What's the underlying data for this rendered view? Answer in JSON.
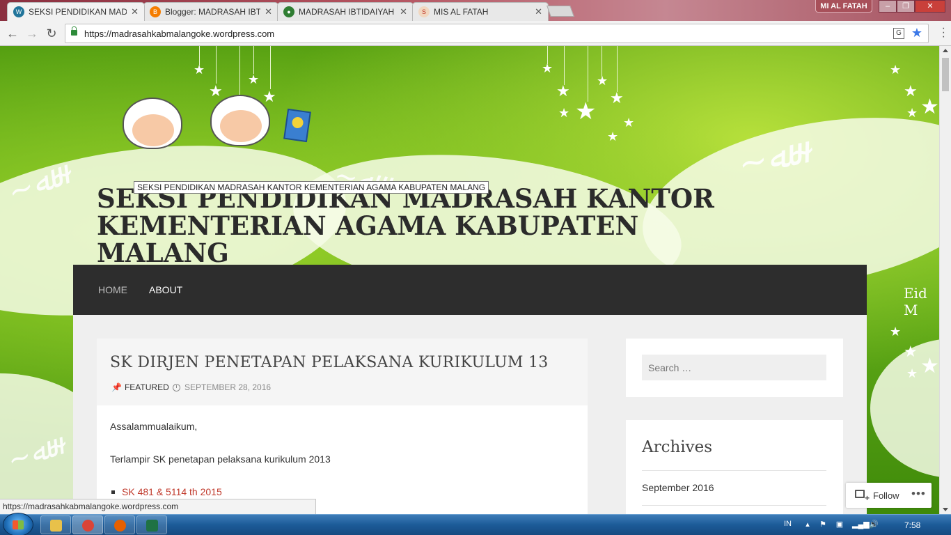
{
  "browser": {
    "tabs": [
      {
        "label": "SEKSI PENDIDIKAN MAD",
        "favicon": "wordpress-icon",
        "color": "#21759b",
        "active": true
      },
      {
        "label": "Blogger: MADRASAH IBT",
        "favicon": "blogger-icon",
        "color": "#f57d00",
        "active": false
      },
      {
        "label": "MADRASAH IBTIDAIYAH",
        "favicon": "kemenag-icon",
        "color": "#2f7d32",
        "active": false
      },
      {
        "label": "MIS AL FATAH",
        "favicon": "ship-icon",
        "color": "#e0e0e0",
        "active": false
      }
    ],
    "profile_name": "MI AL FATAH",
    "url": "https://madrasahkabmalangoke.wordpress.com",
    "status_url": "https://madrasahkabmalangoke.wordpress.com"
  },
  "site": {
    "tooltip": "SEKSI PENDIDIKAN MADRASAH KANTOR KEMENTERIAN AGAMA KABUPATEN MALANG",
    "title": "SEKSI PENDIDIKAN MADRASAH KANTOR KEMENTERIAN AGAMA KABUPATEN MALANG",
    "header_text": "Eid M",
    "nav": [
      {
        "label": "HOME"
      },
      {
        "label": "ABOUT"
      }
    ]
  },
  "post": {
    "title": "SK DIRJEN PENETAPAN PELAKSANA KURIKULUM 13",
    "category": "FEATURED",
    "date": "SEPTEMBER 28, 2016",
    "paragraphs": [
      "Assalammualaikum,",
      "Terlampir SK penetapan pelaksana kurikulum 2013"
    ],
    "links": [
      "SK 481 & 5114 th 2015"
    ]
  },
  "sidebar": {
    "search_placeholder": "Search …",
    "archives_title": "Archives",
    "archives": [
      "September 2016"
    ]
  },
  "follow": {
    "label": "Follow",
    "more": "•••"
  },
  "taskbar": {
    "lang": "IN",
    "time": "7:58",
    "apps": [
      {
        "name": "explorer",
        "color": "#e8c14a"
      },
      {
        "name": "chrome",
        "color": "#db4437"
      },
      {
        "name": "firefox",
        "color": "#e66000"
      },
      {
        "name": "excel",
        "color": "#1f7244"
      }
    ]
  }
}
